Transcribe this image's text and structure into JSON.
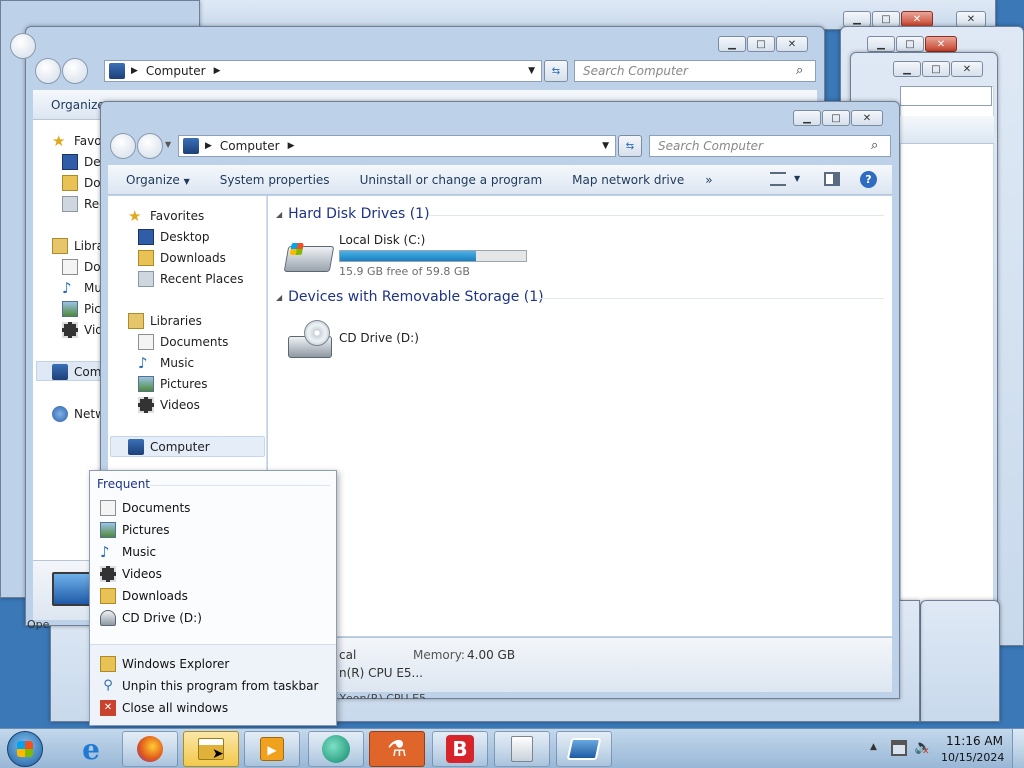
{
  "front_window": {
    "address": {
      "root_label": "Computer"
    },
    "search": {
      "placeholder": "Search Computer"
    },
    "toolbar": {
      "organize": "Organize",
      "system_properties": "System properties",
      "uninstall": "Uninstall or change a program",
      "map_drive": "Map network drive",
      "more": "»"
    },
    "nav": {
      "favorites": "Favorites",
      "desktop": "Desktop",
      "downloads": "Downloads",
      "recent": "Recent Places",
      "libraries": "Libraries",
      "documents": "Documents",
      "music": "Music",
      "pictures": "Pictures",
      "videos": "Videos",
      "computer": "Computer"
    },
    "groups": {
      "hdd_header": "Hard Disk Drives (1)",
      "removable_header": "Devices with Removable Storage (1)"
    },
    "drives": {
      "c_name": "Local Disk (C:)",
      "c_free": "15.9 GB free of 59.8 GB",
      "c_used_fraction": 0.73,
      "d_name": "CD Drive (D:)"
    },
    "status": {
      "domain_partial": "cal",
      "memory_label": "Memory:",
      "memory_value": "4.00 GB",
      "cpu_partial": "n(R) CPU E5...",
      "cpu_partial2": "Xeon(R) CPU E5..."
    }
  },
  "back_window": {
    "address": {
      "root_label": "Computer"
    },
    "search": {
      "placeholder": "Search Computer"
    },
    "organize": "Organize",
    "nav": {
      "favorites": "Favo",
      "desktop": "Des",
      "downloads": "Dov",
      "recent": "Rec",
      "libraries": "Libra",
      "documents": "Doc",
      "music": "Mu",
      "pictures": "Pic",
      "videos": "Vid",
      "computer": "Com",
      "network": "Netw"
    },
    "footer_partial": "Ope"
  },
  "jumplist": {
    "frequent_header": "Frequent",
    "items": [
      "Documents",
      "Pictures",
      "Music",
      "Videos",
      "Downloads",
      "CD Drive (D:)"
    ],
    "tasks": [
      "Windows Explorer",
      "Unpin this program from taskbar",
      "Close all windows"
    ]
  },
  "tray": {
    "time": "11:16 AM",
    "date": "10/15/2024"
  },
  "colors": {
    "desktop": "#3a78b8",
    "progress": "#2a8fc9",
    "header_text": "#1e3287",
    "close_red": "#c7432d"
  }
}
